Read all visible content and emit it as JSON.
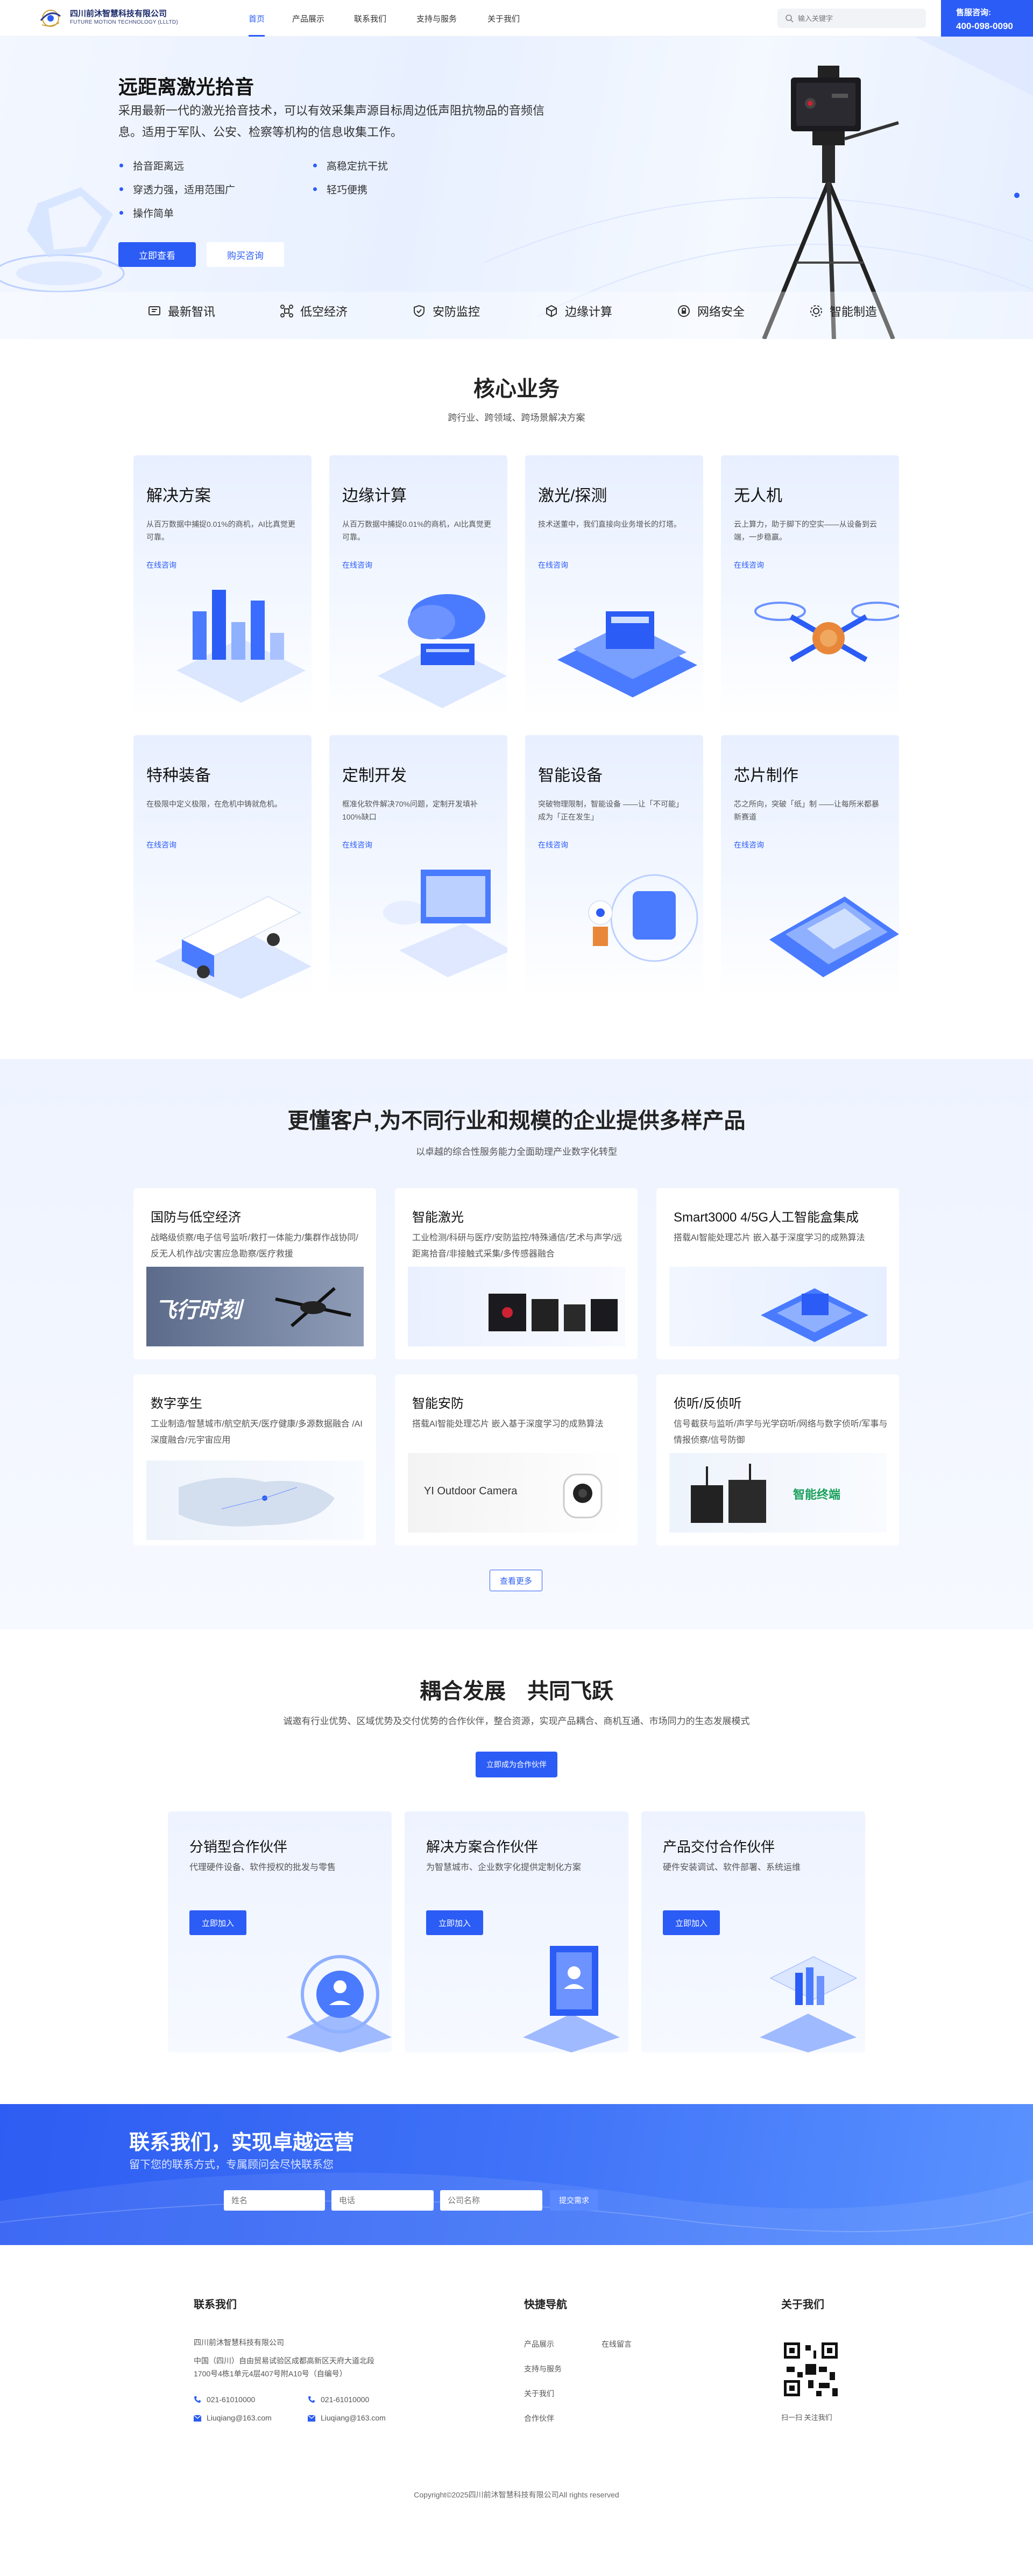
{
  "header": {
    "company_cn": "四川前沐智慧科技有限公司",
    "company_en": "FUTURE MOTION TECHNOLOGY (LLLTD)",
    "nav": [
      "首页",
      "产品展示",
      "联系我们",
      "支持与服务",
      "关于我们"
    ],
    "active_nav": "首页",
    "search_placeholder": "输入关键字",
    "hotline_label": "售服咨询:",
    "hotline_number": "400-098-0090"
  },
  "hero": {
    "title": "远距离激光拾音",
    "description": "采用最新一代的激光拾音技术，可以有效采集声源目标周边低声阻抗物品的音频信息。适用于军队、公安、检察等机构的信息收集工作。",
    "features_left": [
      "拾音距离远",
      "穿透力强，适用范围广",
      "操作简单"
    ],
    "features_right": [
      "高稳定抗干扰",
      "轻巧便携"
    ],
    "btn_view": "立即查看",
    "btn_buy": "购买咨询",
    "quick_nav": [
      {
        "label": "最新智讯",
        "icon": "news-icon"
      },
      {
        "label": "低空经济",
        "icon": "drone-icon"
      },
      {
        "label": "安防监控",
        "icon": "shield-icon"
      },
      {
        "label": "边缘计算",
        "icon": "cube-icon"
      },
      {
        "label": "网络安全",
        "icon": "lock-icon"
      },
      {
        "label": "智能制造",
        "icon": "gear-icon"
      }
    ]
  },
  "core": {
    "title": "核心业务",
    "subtitle": "跨行业、跨领域、跨场景解决方案",
    "consult_label": "在线咨询",
    "cards": [
      {
        "title": "解决方案",
        "desc": "从百万数据中捕捉0.01%的商机，AI比真觉更可靠。"
      },
      {
        "title": "边缘计算",
        "desc": "从百万数据中捕捉0.01%的商机，AI比真觉更可靠。"
      },
      {
        "title": "激光/探测",
        "desc": "技术送董中，我们直接向业务增长的灯塔。"
      },
      {
        "title": "无人机",
        "desc": "云上算力，助于脚下的空实——从设备到云端，一步稳赢。"
      },
      {
        "title": "特种装备",
        "desc": "在极限中定义极限，在危机中铸就危机。"
      },
      {
        "title": "定制开发",
        "desc": "框准化软件解决70%问题，定制开发填补100%缺口"
      },
      {
        "title": "智能设备",
        "desc": "突破物理限制，智能设备 ——让「不可能」成为「正在发生」"
      },
      {
        "title": "芯片制作",
        "desc": "芯之所向，突破「纸」制 ——让每所米都暴新赛道"
      }
    ]
  },
  "products": {
    "title": "更懂客户,为不同行业和规模的企业提供多样产品",
    "subtitle": "以卓越的综合性服务能力全面助理产业数字化转型",
    "more_label": "查看更多",
    "cards": [
      {
        "title": "国防与低空经济",
        "desc": "战略级侦察/电子信号监听/救打一体能力/集群作战协同/反无人机作战/灾害应急勘察/医疗救援",
        "img_text": "飞行时刻"
      },
      {
        "title": "智能激光",
        "desc": "工业检测/科研与医疗/安防监控/特殊通信/艺术与声学/远距离拾音/非接触式采集/多传感器融合",
        "img_text": ""
      },
      {
        "title": "Smart3000 4/5G人工智能盒集成",
        "desc": "搭载AI智能处理芯片 嵌入基于深度学习的成熟算法",
        "img_text": ""
      },
      {
        "title": "数字孪生",
        "desc": "工业制造/智慧城市/航空航天/医疗健康/多源数据融合 /AI 深度融合/元宇宙应用",
        "img_text": ""
      },
      {
        "title": "智能安防",
        "desc": "搭载AI智能处理芯片 嵌入基于深度学习的成熟算法",
        "img_text": "YI Outdoor Camera"
      },
      {
        "title": "侦听/反侦听",
        "desc": "信号截获与监听/声学与光学窃听/网络与数字侦听/军事与情报侦察/信号防御",
        "img_text": "智能终端"
      }
    ]
  },
  "partners": {
    "title": "耦合发展　共同飞跃",
    "subtitle": "诚邀有行业优势、区域优势及交付优势的合作伙伴，整合资源，实现产品耦合、商机互通、市场同力的生态发展模式",
    "cta": "立即成为合作伙伴",
    "join_label": "立即加入",
    "cards": [
      {
        "title": "分销型合作伙伴",
        "desc": "代理硬件设备、软件授权的批发与零售"
      },
      {
        "title": "解决方案合作伙伴",
        "desc": "为智慧城市、企业数字化提供定制化方案"
      },
      {
        "title": "产品交付合作伙伴",
        "desc": "硬件安装调试、软件部署、系统运维"
      }
    ]
  },
  "contact": {
    "title": "联系我们，实现卓越运营",
    "subtitle": "留下您的联系方式，专属顾问会尽快联系您",
    "ph_name": "姓名",
    "ph_phone": "电话",
    "ph_company": "公司名称",
    "submit": "提交需求"
  },
  "footer": {
    "contact_title": "联系我们",
    "company": "四川前沐智慧科技有限公司",
    "address_line1": "中国（四川）自由贸易试验区成都高新区天府大道北段",
    "address_line2": "1700号4栋1单元4层407号附A10号（自编号）",
    "phone1": "021-61010000",
    "phone2": "021-61010000",
    "email1": "Liuqiang@163.com",
    "email2": "Liuqiang@163.com",
    "nav_title": "快捷导航",
    "nav_col1": [
      "产品展示",
      "支持与服务",
      "关于我们",
      "合作伙伴"
    ],
    "nav_col2": [
      "在线留言"
    ],
    "about_title": "关于我们",
    "qr_caption": "扫一扫 关注我们",
    "copyright": "Copyright©2025四川前沐智慧科技有限公司All rights reserved"
  },
  "colors": {
    "primary": "#2b5cf5",
    "hero_bg": "#eef3ff",
    "contact_bg": "#3a6cf6"
  }
}
